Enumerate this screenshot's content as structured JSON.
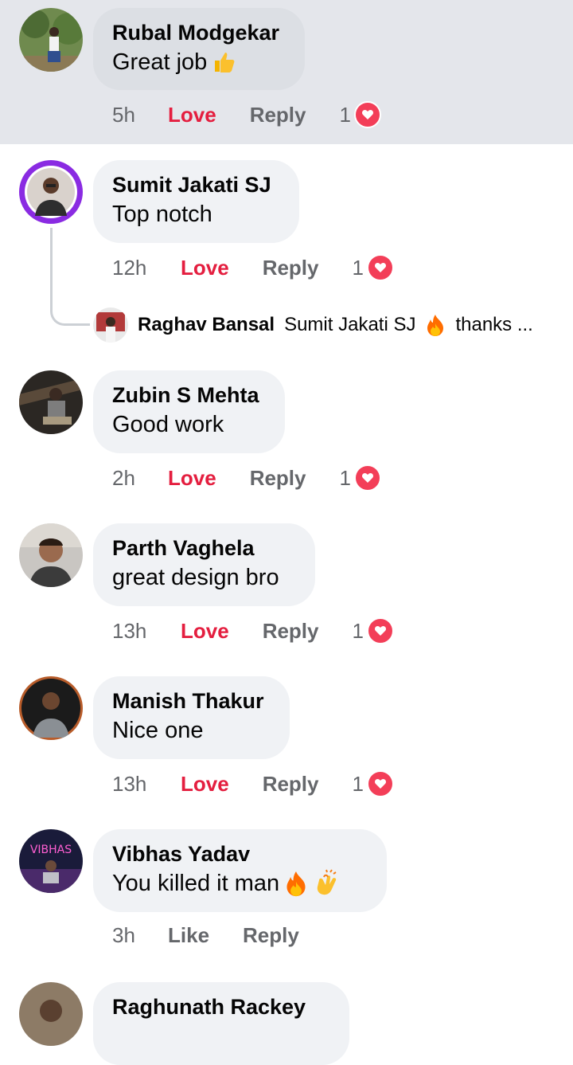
{
  "colors": {
    "love": "#e41e3f",
    "meta": "#65676b",
    "bubble": "#f0f2f5",
    "highlight": "#e4e6eb",
    "heart": "#f33e58"
  },
  "comments": [
    {
      "author": "Rubal Modgekar",
      "text": "Great job",
      "emoji": [
        "thumbs-up"
      ],
      "time": "5h",
      "reaction_label": "Love",
      "reply_label": "Reply",
      "reaction_count": "1",
      "highlighted": true
    },
    {
      "author": "Sumit Jakati SJ",
      "text": "Top notch",
      "emoji": [],
      "time": "12h",
      "reaction_label": "Love",
      "reply_label": "Reply",
      "reaction_count": "1"
    },
    {
      "author": "Zubin S Mehta",
      "text": "Good work",
      "emoji": [],
      "time": "2h",
      "reaction_label": "Love",
      "reply_label": "Reply",
      "reaction_count": "1"
    },
    {
      "author": "Parth Vaghela",
      "text": "great design bro",
      "emoji": [],
      "time": "13h",
      "reaction_label": "Love",
      "reply_label": "Reply",
      "reaction_count": "1"
    },
    {
      "author": "Manish Thakur",
      "text": "Nice one",
      "emoji": [],
      "time": "13h",
      "reaction_label": "Love",
      "reply_label": "Reply",
      "reaction_count": "1"
    },
    {
      "author": "Vibhas Yadav",
      "text": "You killed it man",
      "emoji": [
        "fire",
        "clapping-hands"
      ],
      "time": "3h",
      "reaction_label": "Like",
      "reply_label": "Reply",
      "reaction_count": ""
    },
    {
      "author": "Raghunath Rackey",
      "text": "",
      "emoji": [],
      "time": "",
      "partial": true
    }
  ],
  "reply_preview": {
    "author": "Raghav Bansal",
    "text_before": "Sumit Jakati SJ",
    "emoji": "fire",
    "text_after": "thanks ..."
  },
  "avatar_labels": {
    "vibhas": "VIBHAS"
  }
}
